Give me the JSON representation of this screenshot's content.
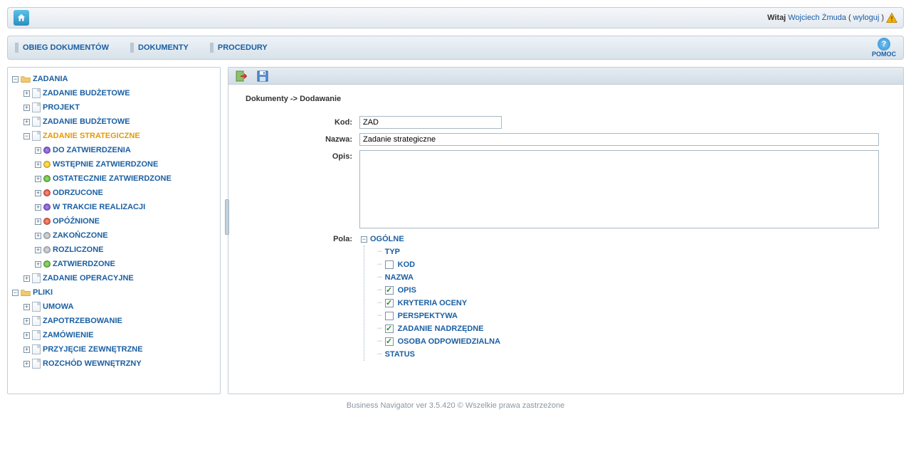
{
  "header": {
    "welcome_prefix": "Witaj",
    "user_name": "Wojciech Żmuda",
    "logout": "wyloguj"
  },
  "menu": {
    "obieg": "OBIEG DOKUMENTÓW",
    "dokumenty": "DOKUMENTY",
    "procedury": "PROCEDURY",
    "help": "POMOC"
  },
  "tree": {
    "zadania": "ZADANIA",
    "zadanie_budzetowe": "ZADANIE BUDŻETOWE",
    "projekt": "PROJEKT",
    "zadanie_budzetowe2": "ZADANIE BUDŻETOWE",
    "zadanie_strategiczne": "ZADANIE STRATEGICZNE",
    "do_zatwierdzenia": "DO ZATWIERDZENIA",
    "wstepnie": "WSTĘPNIE ZATWIERDZONE",
    "ostatecznie": "OSTATECZNIE ZATWIERDZONE",
    "odrzucone": "ODRZUCONE",
    "w_trakcie": "W TRAKCIE REALIZACJI",
    "opoznione": "OPÓŹNIONE",
    "zakonczone": "ZAKOŃCZONE",
    "rozliczone": "ROZLICZONE",
    "zatwierdzone": "ZATWIERDZONE",
    "zadanie_operacyjne": "ZADANIE OPERACYJNE",
    "pliki": "PLIKI",
    "umowa": "UMOWA",
    "zapotrzebowanie": "ZAPOTRZEBOWANIE",
    "zamowienie": "ZAMÓWIENIE",
    "przyjecie": "PRZYJĘCIE ZEWNĘTRZNE",
    "rozchod": "ROZCHÓD WEWNĘTRZNY"
  },
  "main": {
    "breadcrumb": "Dokumenty -> Dodawanie",
    "labels": {
      "kod": "Kod:",
      "nazwa": "Nazwa:",
      "opis": "Opis:",
      "pola": "Pola:"
    },
    "values": {
      "kod": "ZAD",
      "nazwa": "Zadanie strategiczne",
      "opis": ""
    },
    "pola": {
      "ogolne": "OGÓLNE",
      "typ": "TYP",
      "kod": "KOD",
      "nazwa": "NAZWA",
      "opis": "OPIS",
      "kryteria": "KRYTERIA OCENY",
      "perspektywa": "PERSPEKTYWA",
      "zadanie_nad": "ZADANIE NADRZĘDNE",
      "osoba": "OSOBA ODPOWIEDZIALNA",
      "status": "STATUS"
    }
  },
  "footer": "Business Navigator ver 3.5.420 © Wszelkie prawa zastrzeżone"
}
